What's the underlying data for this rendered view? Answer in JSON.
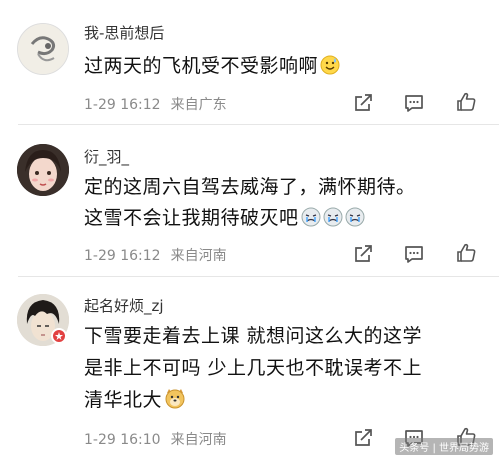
{
  "comments": [
    {
      "username": "我-思前想后",
      "lines": [
        "过两天的飞机受不受影响啊"
      ],
      "time": "1-29 16:12",
      "location": "来自广东",
      "emoji": "sweat-smile-emoji"
    },
    {
      "username": "衍_羽_",
      "lines": [
        "定的这周六自驾去威海了，满怀期待。",
        "这雪不会让我期待破灭吧"
      ],
      "time": "1-29 16:12",
      "location": "来自河南",
      "emoji": "crying-emoji"
    },
    {
      "username": "起名好烦_zj",
      "lines": [
        "下雪要走着去上课 就想问这么大的这学",
        "是非上不可吗 少上几天也不耽误考不上",
        "清华北大"
      ],
      "time": "1-29 16:10",
      "location": "来自河南",
      "emoji": "doge-emoji"
    }
  ],
  "actions": {
    "icons": [
      "share-icon",
      "comment-icon",
      "like-icon"
    ]
  },
  "watermark": "头条号 | 世界局势游",
  "colors": {
    "username": "#333333",
    "text": "#111111",
    "meta": "#8a8a8a",
    "divider": "#e6e6e6",
    "icon": "#555555"
  }
}
